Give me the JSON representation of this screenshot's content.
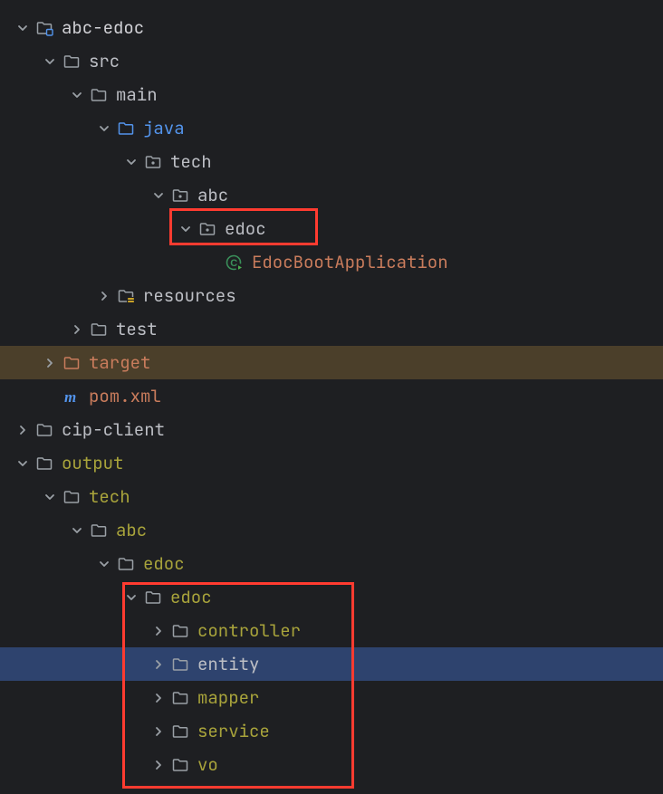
{
  "tree": [
    {
      "indent": 0,
      "chevron": "down",
      "icon": "module",
      "label": "abc-edoc",
      "color": "c-module"
    },
    {
      "indent": 1,
      "chevron": "down",
      "icon": "folder",
      "label": "src",
      "color": "c-default"
    },
    {
      "indent": 2,
      "chevron": "down",
      "icon": "folder",
      "label": "main",
      "color": "c-default"
    },
    {
      "indent": 3,
      "chevron": "down",
      "icon": "folder-src",
      "label": "java",
      "color": "c-source-root"
    },
    {
      "indent": 4,
      "chevron": "down",
      "icon": "package",
      "label": "tech",
      "color": "c-default"
    },
    {
      "indent": 5,
      "chevron": "down",
      "icon": "package",
      "label": "abc",
      "color": "c-default"
    },
    {
      "indent": 6,
      "chevron": "down",
      "icon": "package",
      "label": "edoc",
      "color": "c-default"
    },
    {
      "indent": 7,
      "chevron": "none",
      "icon": "class",
      "label": "EdocBootApplication",
      "color": "c-class"
    },
    {
      "indent": 3,
      "chevron": "right",
      "icon": "folder-res",
      "label": "resources",
      "color": "c-default"
    },
    {
      "indent": 2,
      "chevron": "right",
      "icon": "folder",
      "label": "test",
      "color": "c-default"
    },
    {
      "indent": 1,
      "chevron": "right",
      "icon": "folder-excl",
      "label": "target",
      "color": "c-excluded",
      "rowClass": "highlighted"
    },
    {
      "indent": 1,
      "chevron": "none",
      "icon": "maven",
      "label": "pom.xml",
      "color": "c-file"
    },
    {
      "indent": 0,
      "chevron": "right",
      "icon": "folder",
      "label": "cip-client",
      "color": "c-default"
    },
    {
      "indent": 0,
      "chevron": "down",
      "icon": "folder",
      "label": "output",
      "color": "c-generated"
    },
    {
      "indent": 1,
      "chevron": "down",
      "icon": "folder",
      "label": "tech",
      "color": "c-generated"
    },
    {
      "indent": 2,
      "chevron": "down",
      "icon": "folder",
      "label": "abc",
      "color": "c-generated"
    },
    {
      "indent": 3,
      "chevron": "down",
      "icon": "folder",
      "label": "edoc",
      "color": "c-generated"
    },
    {
      "indent": 4,
      "chevron": "down",
      "icon": "folder",
      "label": "edoc",
      "color": "c-generated"
    },
    {
      "indent": 5,
      "chevron": "right",
      "icon": "folder",
      "label": "controller",
      "color": "c-generated"
    },
    {
      "indent": 5,
      "chevron": "right",
      "icon": "folder",
      "label": "entity",
      "color": "c-default",
      "rowClass": "selected"
    },
    {
      "indent": 5,
      "chevron": "right",
      "icon": "folder",
      "label": "mapper",
      "color": "c-generated"
    },
    {
      "indent": 5,
      "chevron": "right",
      "icon": "folder",
      "label": "service",
      "color": "c-generated"
    },
    {
      "indent": 5,
      "chevron": "right",
      "icon": "folder",
      "label": "vo",
      "color": "c-generated"
    }
  ]
}
